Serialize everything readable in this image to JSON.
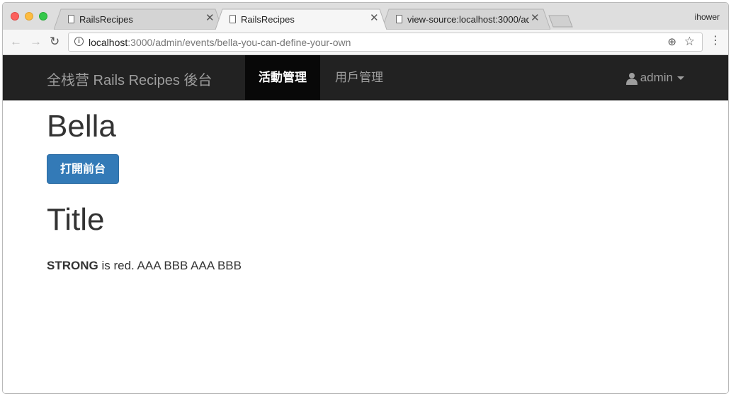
{
  "browser": {
    "profile_name": "ihower",
    "tabs": [
      {
        "title": "RailsRecipes",
        "active": false
      },
      {
        "title": "RailsRecipes",
        "active": true
      },
      {
        "title": "view-source:localhost:3000/ad",
        "active": false
      }
    ],
    "close_glyph": "✕",
    "address": {
      "host": "localhost",
      "path": ":3000/admin/events/bella-you-can-define-your-own"
    },
    "icons": {
      "back": "←",
      "forward": "→",
      "reload": "↻",
      "info": "i",
      "zoom": "⊕",
      "star": "☆",
      "menu": "⋮"
    }
  },
  "navbar": {
    "brand": "全栈营 Rails Recipes 後台",
    "links": [
      "活動管理",
      "用戶管理"
    ],
    "active_link": 0,
    "user": "admin",
    "colors": {
      "background": "#222222",
      "active_background": "#080808",
      "link": "#9d9d9d"
    }
  },
  "page": {
    "event_name": "Bella",
    "front_button": "打開前台",
    "section_heading": "Title",
    "description_strong": "STRONG",
    "description_rest": " is red. AAA BBB AAA BBB",
    "colors": {
      "primary_button": "#337ab7",
      "text": "#333333"
    }
  }
}
